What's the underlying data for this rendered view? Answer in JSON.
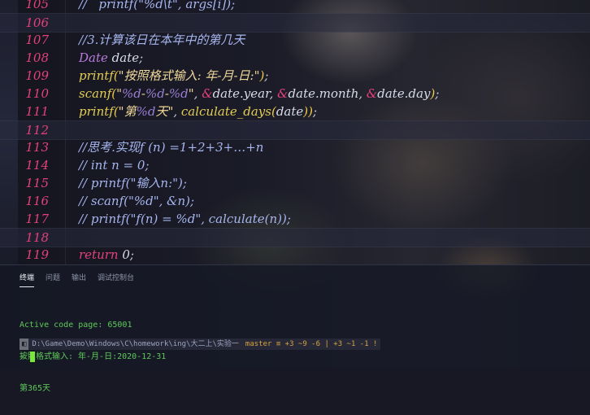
{
  "editor": {
    "lines": [
      {
        "num": "105",
        "tokens": [
          [
            "c-comment",
            "//   printf(\"%d\\t\", args[i]);"
          ]
        ]
      },
      {
        "num": "106",
        "tokens": []
      },
      {
        "num": "107",
        "tokens": [
          [
            "c-comment",
            "//3.计算该日在本年中的第几天"
          ]
        ]
      },
      {
        "num": "108",
        "tokens": [
          [
            "c-type",
            "Date"
          ],
          [
            "c-var",
            " date"
          ],
          [
            "c-punc",
            ";"
          ]
        ]
      },
      {
        "num": "109",
        "tokens": [
          [
            "c-func",
            "printf"
          ],
          [
            "c-paren",
            "("
          ],
          [
            "c-str",
            "\"按照格式输入: 年-月-日:\""
          ],
          [
            "c-paren",
            ")"
          ],
          [
            "c-punc",
            ";"
          ]
        ]
      },
      {
        "num": "110",
        "tokens": [
          [
            "c-func",
            "scanf"
          ],
          [
            "c-paren",
            "("
          ],
          [
            "c-str",
            "\""
          ],
          [
            "c-fmt",
            "%d"
          ],
          [
            "c-str",
            "-"
          ],
          [
            "c-fmt",
            "%d"
          ],
          [
            "c-str",
            "-"
          ],
          [
            "c-fmt",
            "%d"
          ],
          [
            "c-str",
            "\""
          ],
          [
            "c-punc",
            ", "
          ],
          [
            "c-amp",
            "&"
          ],
          [
            "c-var",
            "date.year"
          ],
          [
            "c-punc",
            ", "
          ],
          [
            "c-amp",
            "&"
          ],
          [
            "c-var",
            "date.month"
          ],
          [
            "c-punc",
            ", "
          ],
          [
            "c-amp",
            "&"
          ],
          [
            "c-var",
            "date.day"
          ],
          [
            "c-paren",
            ")"
          ],
          [
            "c-punc",
            ";"
          ]
        ]
      },
      {
        "num": "111",
        "tokens": [
          [
            "c-func",
            "printf"
          ],
          [
            "c-paren",
            "("
          ],
          [
            "c-str",
            "\"第"
          ],
          [
            "c-fmt",
            "%d"
          ],
          [
            "c-str",
            "天\""
          ],
          [
            "c-punc",
            ", "
          ],
          [
            "c-func",
            "calculate_days"
          ],
          [
            "c-paren",
            "("
          ],
          [
            "c-var",
            "date"
          ],
          [
            "c-paren",
            "))"
          ],
          [
            "c-punc",
            ";"
          ]
        ]
      },
      {
        "num": "112",
        "tokens": []
      },
      {
        "num": "113",
        "tokens": [
          [
            "c-comment",
            "//思考.实现f (n) =1+2+3+…+n"
          ]
        ]
      },
      {
        "num": "114",
        "tokens": [
          [
            "c-comment",
            "// int n = 0;"
          ]
        ]
      },
      {
        "num": "115",
        "tokens": [
          [
            "c-comment",
            "// printf(\"输入n:\");"
          ]
        ]
      },
      {
        "num": "116",
        "tokens": [
          [
            "c-comment",
            "// scanf(\"%d\", &n);"
          ]
        ]
      },
      {
        "num": "117",
        "tokens": [
          [
            "c-comment",
            "// printf(\"f(n) = %d\", calculate(n));"
          ]
        ]
      },
      {
        "num": "118",
        "tokens": []
      },
      {
        "num": "119",
        "tokens": [
          [
            "c-kw",
            "return"
          ],
          [
            "c-var",
            " 0"
          ],
          [
            "c-punc",
            ";"
          ]
        ]
      }
    ]
  },
  "panel": {
    "tabs": [
      "终端",
      "问题",
      "输出",
      "调试控制台"
    ],
    "active_tab": 0,
    "output": {
      "line1": "Active code page: 65001",
      "line2": "按照格式输入: 年-月-日:2020-12-31",
      "line3": "第365天"
    },
    "prompt": {
      "icon": "◧",
      "path": " D:\\Game\\Demo\\Windows\\C\\homework\\ing\\大二上\\实验一 ",
      "git": " master ≡ +3 ~9 -6 | +3 ~1 -1 ! "
    }
  },
  "colors": {
    "line_number": "#e4417c",
    "terminal_text": "#5fc95a",
    "cursor": "#79e63a"
  }
}
